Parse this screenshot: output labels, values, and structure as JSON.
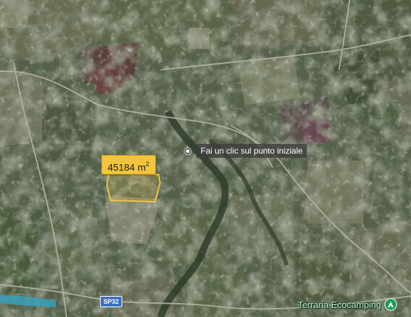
{
  "measurement": {
    "area_value": "45184 m",
    "area_unit_exponent": "2",
    "polygon_stroke": "#f2c53d",
    "polygon_fill": "#f2c53d"
  },
  "tooltip": {
    "text": "Fai un clic sul punto iniziale",
    "icon": "point-marker-icon"
  },
  "road": {
    "label": "SP32",
    "shield_color": "#3b6fc0"
  },
  "poi": {
    "label": "Terraria Ecocamping",
    "icon": "campground-icon",
    "color": "#1e9e5a"
  }
}
